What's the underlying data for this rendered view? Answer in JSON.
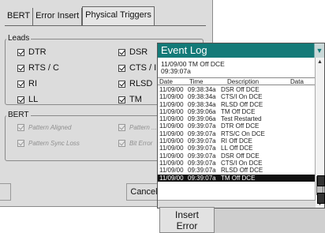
{
  "tabs": [
    "BERT",
    "Error Insert",
    "Physical Triggers"
  ],
  "leads": {
    "title": "Leads",
    "items": [
      {
        "label": "DTR",
        "checked": true
      },
      {
        "label": "DSR",
        "checked": true
      },
      {
        "label": "RTS / C",
        "checked": true
      },
      {
        "label": "CTS / I",
        "checked": true
      },
      {
        "label": "RI",
        "checked": true
      },
      {
        "label": "RLSD",
        "checked": true
      },
      {
        "label": "LL",
        "checked": true
      },
      {
        "label": "TM",
        "checked": true
      }
    ]
  },
  "bert": {
    "title": "BERT",
    "items": [
      {
        "label": "Pattern Aligned",
        "checked": true
      },
      {
        "label": "Pattern ...",
        "checked": true
      },
      {
        "label": "Pattern Sync Loss",
        "checked": true
      },
      {
        "label": "Bit Error",
        "checked": true
      }
    ]
  },
  "buttons": {
    "cancel": "Cancel",
    "insert_error_line1": "Insert",
    "insert_error_line2": "Error"
  },
  "event_log": {
    "title": "Event Log",
    "info_line1": "11/09/00  TM Off DCE",
    "info_line2": "09:39:07a",
    "columns": [
      "Date",
      "Time",
      "Description",
      "Data"
    ],
    "rows": [
      {
        "date": "11/09/00",
        "time": "09:38:34a",
        "desc": "DSR Off DCE"
      },
      {
        "date": "11/09/00",
        "time": "09:38:34a",
        "desc": "CTS/I On DCE"
      },
      {
        "date": "11/09/00",
        "time": "09:38:34a",
        "desc": "RLSD Off DCE"
      },
      {
        "date": "11/09/00",
        "time": "09:39:06a",
        "desc": "TM Off DCE"
      },
      {
        "date": "11/09/00",
        "time": "09:39:06a",
        "desc": "Test Restarted"
      },
      {
        "date": "11/09/00",
        "time": "09:39:07a",
        "desc": "DTR Off DCE"
      },
      {
        "date": "11/09/00",
        "time": "09:39:07a",
        "desc": "RTS/C On DCE"
      },
      {
        "date": "11/09/00",
        "time": "09:39:07a",
        "desc": "RI Off DCE"
      },
      {
        "date": "11/09/00",
        "time": "09:39:07a",
        "desc": "LL Off DCE"
      },
      {
        "date": "11/09/00",
        "time": "09:39:07a",
        "desc": "DSR Off DCE"
      },
      {
        "date": "11/09/00",
        "time": "09:39:07a",
        "desc": "CTS/I On DCE"
      },
      {
        "date": "11/09/00",
        "time": "09:39:07a",
        "desc": "RLSD Off DCE"
      },
      {
        "date": "11/09/00",
        "time": "09:39:07a",
        "desc": "TM Off DCE"
      }
    ],
    "selected_index": 12
  },
  "colors": {
    "title_bar": "#147a78",
    "dialog_bg": "#dcdcdc"
  }
}
